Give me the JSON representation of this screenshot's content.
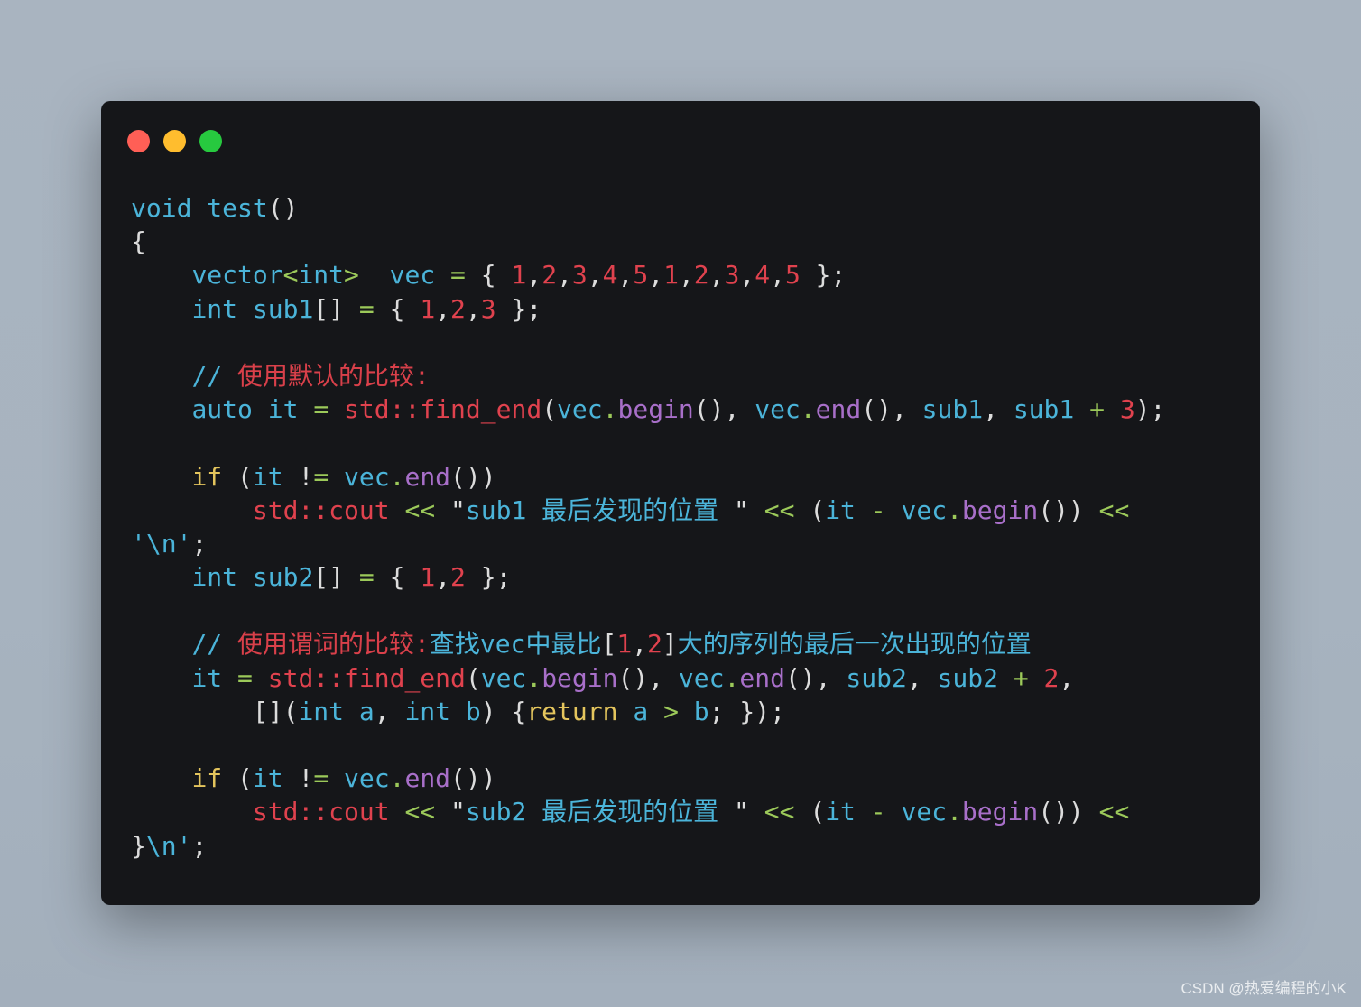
{
  "window": {
    "controls": [
      {
        "name": "close",
        "color": "#ff5f56"
      },
      {
        "name": "minimize",
        "color": "#ffbd2e"
      },
      {
        "name": "maximize",
        "color": "#27c93f"
      }
    ],
    "background_color": "#151619"
  },
  "syntax_colors": {
    "identifier": "#4bb4d9",
    "literal_red": "#e0424e",
    "operator": "#9cc95a",
    "method": "#a86fc9",
    "keyword": "#e4c55d",
    "punctuation": "#dcdcdc"
  },
  "code": {
    "lines": [
      [
        [
          "b",
          "void"
        ],
        [
          "w",
          " "
        ],
        [
          "b",
          "test"
        ],
        [
          "w",
          "()"
        ]
      ],
      [
        [
          "w",
          "{"
        ]
      ],
      [
        [
          "w",
          "    "
        ],
        [
          "b",
          "vector"
        ],
        [
          "g",
          "<"
        ],
        [
          "b",
          "int"
        ],
        [
          "g",
          ">"
        ],
        [
          "w",
          "  "
        ],
        [
          "b",
          "vec"
        ],
        [
          "w",
          " "
        ],
        [
          "g",
          "="
        ],
        [
          "w",
          " { "
        ],
        [
          "r",
          "1"
        ],
        [
          "w",
          ","
        ],
        [
          "r",
          "2"
        ],
        [
          "w",
          ","
        ],
        [
          "r",
          "3"
        ],
        [
          "w",
          ","
        ],
        [
          "r",
          "4"
        ],
        [
          "w",
          ","
        ],
        [
          "r",
          "5"
        ],
        [
          "w",
          ","
        ],
        [
          "r",
          "1"
        ],
        [
          "w",
          ","
        ],
        [
          "r",
          "2"
        ],
        [
          "w",
          ","
        ],
        [
          "r",
          "3"
        ],
        [
          "w",
          ","
        ],
        [
          "r",
          "4"
        ],
        [
          "w",
          ","
        ],
        [
          "r",
          "5"
        ],
        [
          "w",
          " };"
        ]
      ],
      [
        [
          "w",
          "    "
        ],
        [
          "b",
          "int"
        ],
        [
          "w",
          " "
        ],
        [
          "b",
          "sub1"
        ],
        [
          "w",
          "[] "
        ],
        [
          "g",
          "="
        ],
        [
          "w",
          " { "
        ],
        [
          "r",
          "1"
        ],
        [
          "w",
          ","
        ],
        [
          "r",
          "2"
        ],
        [
          "w",
          ","
        ],
        [
          "r",
          "3"
        ],
        [
          "w",
          " };"
        ]
      ],
      [],
      [
        [
          "w",
          "    "
        ],
        [
          "b",
          "//"
        ],
        [
          "w",
          " "
        ],
        [
          "cr",
          "使用默认的比较:"
        ]
      ],
      [
        [
          "w",
          "    "
        ],
        [
          "b",
          "auto"
        ],
        [
          "w",
          " "
        ],
        [
          "b",
          "it"
        ],
        [
          "w",
          " "
        ],
        [
          "g",
          "="
        ],
        [
          "w",
          " "
        ],
        [
          "r",
          "std::find_end"
        ],
        [
          "w",
          "("
        ],
        [
          "b",
          "vec"
        ],
        [
          "g",
          "."
        ],
        [
          "p",
          "begin"
        ],
        [
          "w",
          "(), "
        ],
        [
          "b",
          "vec"
        ],
        [
          "g",
          "."
        ],
        [
          "p",
          "end"
        ],
        [
          "w",
          "(), "
        ],
        [
          "b",
          "sub1"
        ],
        [
          "w",
          ", "
        ],
        [
          "b",
          "sub1"
        ],
        [
          "w",
          " "
        ],
        [
          "g",
          "+"
        ],
        [
          "w",
          " "
        ],
        [
          "r",
          "3"
        ],
        [
          "w",
          ");"
        ]
      ],
      [],
      [
        [
          "w",
          "    "
        ],
        [
          "y",
          "if"
        ],
        [
          "w",
          " ("
        ],
        [
          "b",
          "it"
        ],
        [
          "w",
          " !"
        ],
        [
          "g",
          "="
        ],
        [
          "w",
          " "
        ],
        [
          "b",
          "vec"
        ],
        [
          "g",
          "."
        ],
        [
          "p",
          "end"
        ],
        [
          "w",
          "())"
        ]
      ],
      [
        [
          "w",
          "        "
        ],
        [
          "r",
          "std::cout"
        ],
        [
          "w",
          " "
        ],
        [
          "g",
          "<<"
        ],
        [
          "w",
          " \""
        ],
        [
          "b",
          "sub1 最后发现的位置 "
        ],
        [
          "w",
          "\" "
        ],
        [
          "g",
          "<<"
        ],
        [
          "w",
          " ("
        ],
        [
          "b",
          "it"
        ],
        [
          "w",
          " "
        ],
        [
          "g",
          "-"
        ],
        [
          "w",
          " "
        ],
        [
          "b",
          "vec"
        ],
        [
          "g",
          "."
        ],
        [
          "p",
          "begin"
        ],
        [
          "w",
          "()) "
        ],
        [
          "g",
          "<<"
        ]
      ],
      [
        [
          "b",
          "'\\n'"
        ],
        [
          "w",
          ";"
        ]
      ],
      [
        [
          "w",
          "    "
        ],
        [
          "b",
          "int"
        ],
        [
          "w",
          " "
        ],
        [
          "b",
          "sub2"
        ],
        [
          "w",
          "[] "
        ],
        [
          "g",
          "="
        ],
        [
          "w",
          " { "
        ],
        [
          "r",
          "1"
        ],
        [
          "w",
          ","
        ],
        [
          "r",
          "2"
        ],
        [
          "w",
          " };"
        ]
      ],
      [],
      [
        [
          "w",
          "    "
        ],
        [
          "b",
          "//"
        ],
        [
          "w",
          " "
        ],
        [
          "cr",
          "使用谓词的比较:"
        ],
        [
          "b",
          "查找vec中最比"
        ],
        [
          "w",
          "["
        ],
        [
          "r",
          "1"
        ],
        [
          "w",
          ","
        ],
        [
          "r",
          "2"
        ],
        [
          "w",
          "]"
        ],
        [
          "b",
          "大的序列的最后一次出现的位置"
        ]
      ],
      [
        [
          "w",
          "    "
        ],
        [
          "b",
          "it"
        ],
        [
          "w",
          " "
        ],
        [
          "g",
          "="
        ],
        [
          "w",
          " "
        ],
        [
          "r",
          "std::find_end"
        ],
        [
          "w",
          "("
        ],
        [
          "b",
          "vec"
        ],
        [
          "g",
          "."
        ],
        [
          "p",
          "begin"
        ],
        [
          "w",
          "(), "
        ],
        [
          "b",
          "vec"
        ],
        [
          "g",
          "."
        ],
        [
          "p",
          "end"
        ],
        [
          "w",
          "(), "
        ],
        [
          "b",
          "sub2"
        ],
        [
          "w",
          ", "
        ],
        [
          "b",
          "sub2"
        ],
        [
          "w",
          " "
        ],
        [
          "g",
          "+"
        ],
        [
          "w",
          " "
        ],
        [
          "r",
          "2"
        ],
        [
          "w",
          ","
        ]
      ],
      [
        [
          "w",
          "        []("
        ],
        [
          "b",
          "int"
        ],
        [
          "w",
          " "
        ],
        [
          "b",
          "a"
        ],
        [
          "w",
          ", "
        ],
        [
          "b",
          "int"
        ],
        [
          "w",
          " "
        ],
        [
          "b",
          "b"
        ],
        [
          "w",
          ") {"
        ],
        [
          "y",
          "return"
        ],
        [
          "w",
          " "
        ],
        [
          "b",
          "a"
        ],
        [
          "w",
          " "
        ],
        [
          "g",
          ">"
        ],
        [
          "w",
          " "
        ],
        [
          "b",
          "b"
        ],
        [
          "w",
          "; });"
        ]
      ],
      [],
      [
        [
          "w",
          "    "
        ],
        [
          "y",
          "if"
        ],
        [
          "w",
          " ("
        ],
        [
          "b",
          "it"
        ],
        [
          "w",
          " !"
        ],
        [
          "g",
          "="
        ],
        [
          "w",
          " "
        ],
        [
          "b",
          "vec"
        ],
        [
          "g",
          "."
        ],
        [
          "p",
          "end"
        ],
        [
          "w",
          "())"
        ]
      ],
      [
        [
          "w",
          "        "
        ],
        [
          "r",
          "std::cout"
        ],
        [
          "w",
          " "
        ],
        [
          "g",
          "<<"
        ],
        [
          "w",
          " \""
        ],
        [
          "b",
          "sub2 最后发现的位置 "
        ],
        [
          "w",
          "\" "
        ],
        [
          "g",
          "<<"
        ],
        [
          "w",
          " ("
        ],
        [
          "b",
          "it"
        ],
        [
          "w",
          " "
        ],
        [
          "g",
          "-"
        ],
        [
          "w",
          " "
        ],
        [
          "b",
          "vec"
        ],
        [
          "g",
          "."
        ],
        [
          "p",
          "begin"
        ],
        [
          "w",
          "()) "
        ],
        [
          "g",
          "<<"
        ]
      ],
      [
        [
          "w",
          "}"
        ],
        [
          "b",
          "\\n'"
        ],
        [
          "w",
          ";"
        ]
      ]
    ]
  },
  "watermark": "CSDN @热爱编程的小K"
}
